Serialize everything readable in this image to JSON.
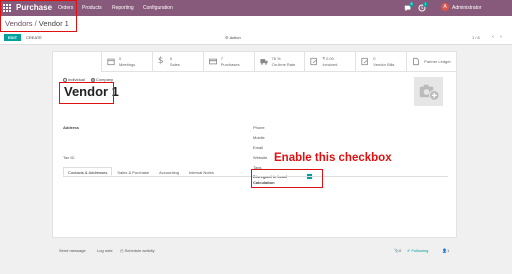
{
  "navbar": {
    "app_name": "Purchase",
    "menu": [
      "Orders",
      "Products",
      "Reporting",
      "Configuration"
    ],
    "chat_badge": "5",
    "activity_badge": "1",
    "avatar_letter": "A",
    "user": "Administrator",
    "color": "#875a7b"
  },
  "breadcrumb": {
    "parent": "Vendors",
    "separator": " / ",
    "current": "Vendor 1"
  },
  "toolbar": {
    "edit": "EDIT",
    "create": "CREATE",
    "action": "Action",
    "pager": "1 / 6"
  },
  "stats": [
    {
      "value": "0",
      "label": "Meetings",
      "icon": "calendar-icon"
    },
    {
      "value": "0",
      "label": "Sales",
      "icon": "dollar-icon"
    },
    {
      "value": "7",
      "label": "Purchases",
      "icon": "credit-card-icon"
    },
    {
      "value": "76 %",
      "label": "On-time Rate",
      "icon": "truck-icon"
    },
    {
      "value": "₹ 0.00",
      "label": "Invoiced",
      "icon": "pencil-icon"
    },
    {
      "value": "0",
      "label": "Vendor Bills",
      "icon": "pencil-icon"
    },
    {
      "value": "",
      "label": "Partner Ledger",
      "icon": "file-icon"
    }
  ],
  "form": {
    "individual": "Individual",
    "company": "Company",
    "name": "Vendor 1",
    "address_label": "Address",
    "tax_id_label": "Tax ID",
    "phone": "Phone",
    "mobile": "Mobile",
    "email": "Email",
    "website": "Website",
    "tags": "Tags",
    "disregard_line1": "Disregard in Lead",
    "disregard_line2": "Calculation"
  },
  "tabs": [
    "Contacts & Addresses",
    "Sales & Purchase",
    "Accounting",
    "Internal Notes"
  ],
  "annotation": "Enable this checkbox",
  "chatter": {
    "send_message": "Send message",
    "log_note": "Log note",
    "schedule_activity": "Schedule activity",
    "attachments": "0",
    "following": "Following",
    "followers": "1"
  },
  "colors": {
    "accent": "#00a09d",
    "brand": "#875a7b",
    "annotation": "#e01010"
  }
}
